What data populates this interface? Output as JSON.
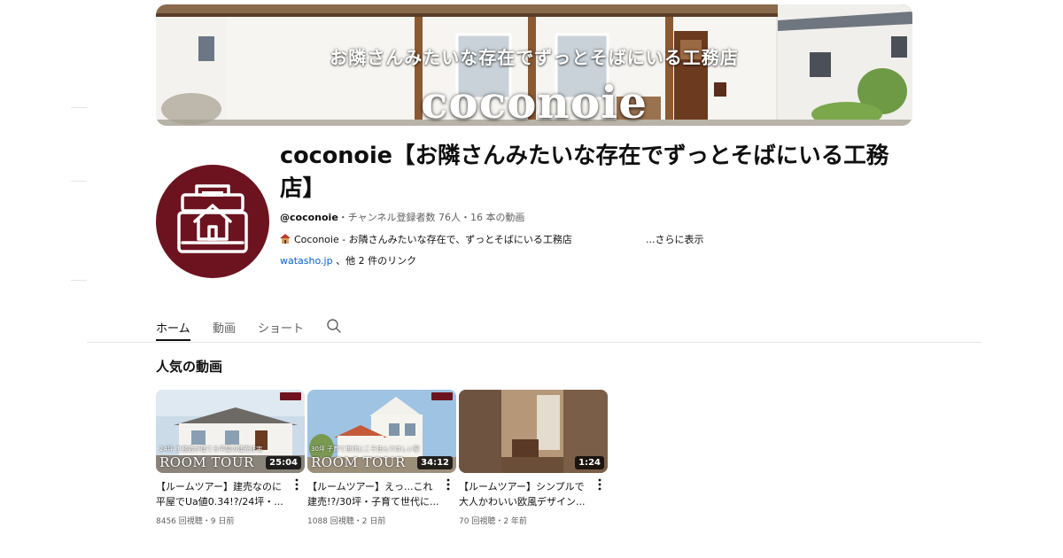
{
  "banner": {
    "tagline": "お隣さんみたいな存在でずっとそばにいる工務店",
    "logo_text": "coconoie"
  },
  "channel": {
    "name": "coconoie【お隣さんみたいな存在でずっとそばにいる工務店】",
    "handle": "@coconoie",
    "stats": "・チャンネル登録者数 76人・16 本の動画",
    "description": "Coconoie - お隣さんみたいな存在で、ずっとそばにいる工務店",
    "more_label": "...さらに表示",
    "link_url": "watasho.jp",
    "link_suffix": " 、他 2 件のリンク",
    "avatar_color": "#6d1320"
  },
  "tabs": [
    {
      "label": "ホーム",
      "active": true
    },
    {
      "label": "動画",
      "active": false
    },
    {
      "label": "ショート",
      "active": false
    }
  ],
  "section_title": "人気の動画",
  "videos": [
    {
      "title": "【ルームツアー】建売なのに平屋でUa値0.34!?/24坪・...",
      "stats": "8456 回視聴・9 日前",
      "duration": "25:04",
      "thumb_label": "ROOM TOUR",
      "thumb_caption": "24坪 工務店が建てる平屋の建売住宅"
    },
    {
      "title": "【ルームツアー】えっ...これ建売!?/30坪・子育て世代に...",
      "stats": "1088 回視聴・2 日前",
      "duration": "34:12",
      "thumb_label": "ROOM TOUR",
      "thumb_caption": "30坪 子育て世代にこそ住んでほしい家"
    },
    {
      "title": "【ルームツアー】シンプルで大人かわいい欧風デザイン...",
      "stats": "70 回視聴・2 年前",
      "duration": "1:24",
      "thumb_label": "",
      "thumb_caption": ""
    }
  ],
  "colors": {
    "accent": "#6d1320",
    "link": "#065fd4",
    "secondary_text": "#606060"
  }
}
